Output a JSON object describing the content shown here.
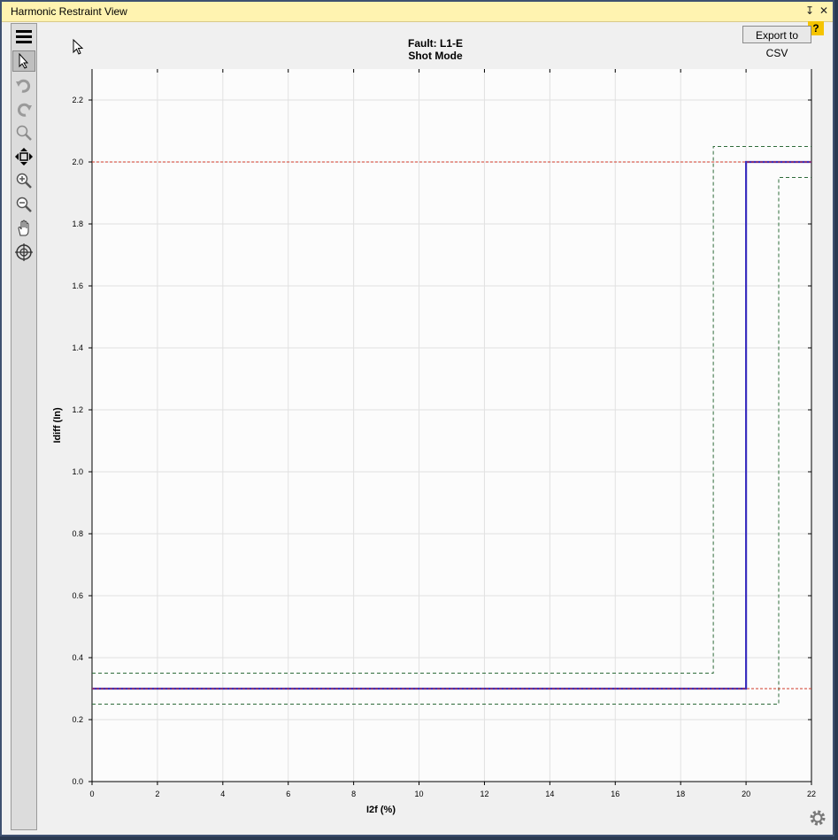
{
  "window": {
    "title": "Harmonic Restraint View",
    "pin_glyph": "↧",
    "close_glyph": "✕"
  },
  "toolbar": {
    "tools": [
      "menu-icon",
      "pointer-icon",
      "undo-icon",
      "redo-icon",
      "zoom-icon",
      "fit-icon",
      "zoom-in-icon",
      "zoom-out-icon",
      "pan-icon",
      "crosshair-icon"
    ]
  },
  "header": {
    "export_label": "Export to CSV",
    "help_label": "?"
  },
  "chart_data": {
    "type": "line",
    "title": "Fault: L1-E",
    "subtitle": "Shot Mode",
    "xlabel": "I2f (%)",
    "ylabel": "Idiff (In)",
    "xlim": [
      0,
      22
    ],
    "ylim": [
      0,
      2.3
    ],
    "xticks": [
      0,
      2,
      4,
      6,
      8,
      10,
      12,
      14,
      16,
      18,
      20,
      22
    ],
    "yticks": [
      0.0,
      0.2,
      0.4,
      0.6,
      0.8,
      1.0,
      1.2,
      1.4,
      1.6,
      1.8,
      2.0,
      2.2
    ],
    "ytick_labels": [
      "0.0",
      "0.2",
      "0.4",
      "0.6",
      "0.8",
      "1.0",
      "1.2",
      "1.4",
      "1.6",
      "1.8",
      "2.0",
      "2.2"
    ],
    "grid": true,
    "series": [
      {
        "color": "#3b2fbf",
        "style": "solid",
        "points": [
          [
            0,
            0.3
          ],
          [
            20,
            0.3
          ],
          [
            20,
            2.0
          ],
          [
            22,
            2.0
          ]
        ]
      },
      {
        "color": "#2e6b3a",
        "style": "dashed",
        "points": [
          [
            0,
            0.35
          ],
          [
            19,
            0.35
          ],
          [
            19,
            2.05
          ],
          [
            22,
            2.05
          ]
        ]
      },
      {
        "color": "#2e6b3a",
        "style": "dashed",
        "points": [
          [
            0,
            0.25
          ],
          [
            21,
            0.25
          ],
          [
            21,
            1.95
          ],
          [
            22,
            1.95
          ]
        ]
      },
      {
        "color": "#d03a2a",
        "style": "dotted",
        "points": [
          [
            0,
            2.0
          ],
          [
            22,
            2.0
          ]
        ]
      },
      {
        "color": "#d03a2a",
        "style": "dotted",
        "points": [
          [
            0,
            0.3
          ],
          [
            22,
            0.3
          ]
        ]
      }
    ]
  }
}
